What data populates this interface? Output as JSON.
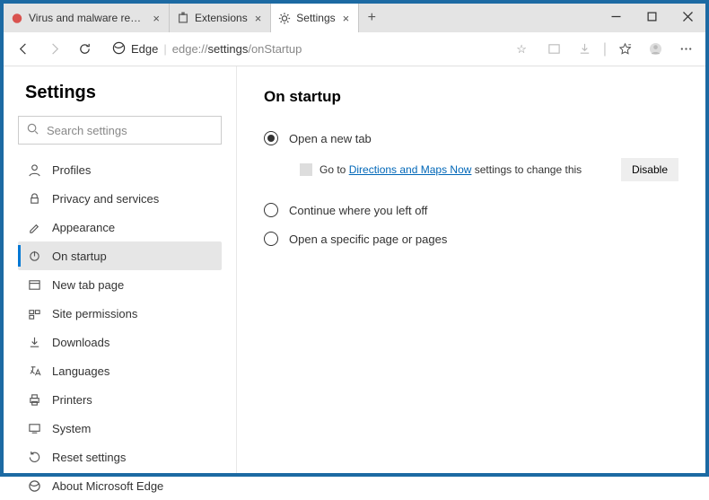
{
  "tabs": [
    {
      "title": "Virus and malware removal instr…"
    },
    {
      "title": "Extensions"
    },
    {
      "title": "Settings"
    }
  ],
  "address": {
    "app": "Edge",
    "protocol": "edge://",
    "bold": "settings",
    "rest": "/onStartup"
  },
  "sidebar": {
    "title": "Settings",
    "search_placeholder": "Search settings",
    "items": [
      {
        "label": "Profiles"
      },
      {
        "label": "Privacy and services"
      },
      {
        "label": "Appearance"
      },
      {
        "label": "On startup"
      },
      {
        "label": "New tab page"
      },
      {
        "label": "Site permissions"
      },
      {
        "label": "Downloads"
      },
      {
        "label": "Languages"
      },
      {
        "label": "Printers"
      },
      {
        "label": "System"
      },
      {
        "label": "Reset settings"
      },
      {
        "label": "About Microsoft Edge"
      }
    ]
  },
  "main": {
    "heading": "On startup",
    "options": {
      "open_new_tab": "Open a new tab",
      "continue": "Continue where you left off",
      "specific": "Open a specific page or pages"
    },
    "extension_row": {
      "prefix": "Go to ",
      "link": "Directions and Maps Now",
      "suffix": " settings to change this",
      "button": "Disable"
    }
  }
}
